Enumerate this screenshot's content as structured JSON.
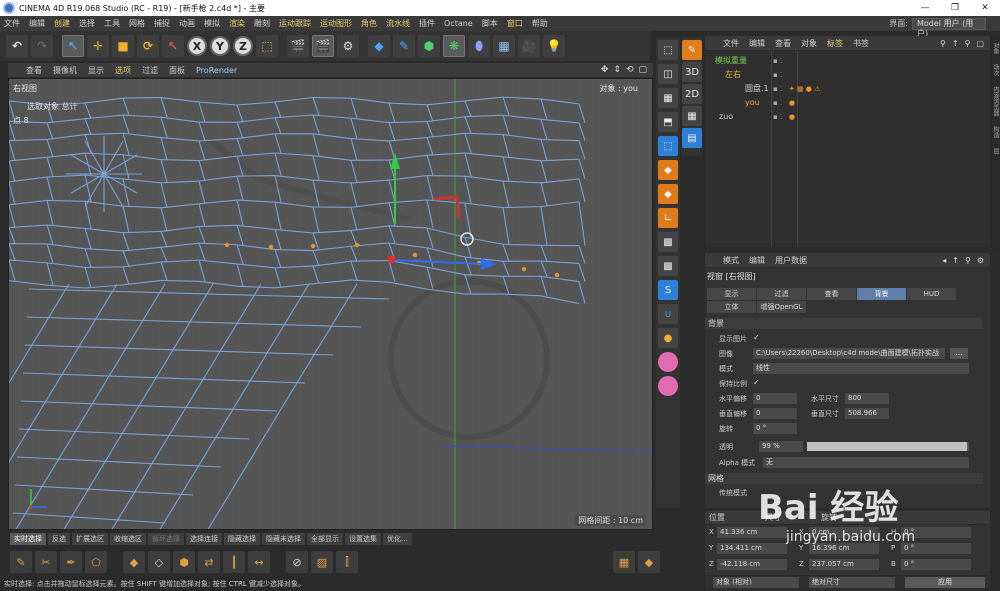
{
  "window": {
    "title": "CINEMA 4D R19.068 Studio (RC - R19) - [新手枪 2.c4d *] - 主要",
    "controls": [
      "—",
      "❐",
      "✕"
    ]
  },
  "menubar": {
    "items": [
      "文件",
      "编辑",
      "创建",
      "选择",
      "工具",
      "网格",
      "捕捉",
      "动画",
      "模拟",
      "渲染",
      "雕刻",
      "运动跟踪",
      "运动图形",
      "角色",
      "流水线",
      "插件",
      "Octane",
      "脚本",
      "窗口",
      "帮助"
    ],
    "layout_label": "界面:",
    "layout_value": "Model 用户 (用户)"
  },
  "viewport_menu": {
    "items": [
      "查看",
      "摄像机",
      "显示",
      "选项",
      "过滤",
      "面板"
    ],
    "prorender": "ProRender"
  },
  "viewport": {
    "name": "右视图",
    "selection_info": "选取对象 总计",
    "points_label": "点",
    "points_value": "8",
    "object_label": "对象 : you",
    "grid_spacing": "网格间距 : 10 cm"
  },
  "object_manager": {
    "menu": [
      "文件",
      "编辑",
      "查看",
      "对象",
      "标签",
      "书签"
    ],
    "objects": [
      {
        "name": "模拟重量",
        "indent": 0,
        "style": "green"
      },
      {
        "name": "左右",
        "indent": 1,
        "style": "sel"
      },
      {
        "name": "圆盘.1",
        "indent": 2,
        "style": "normal"
      },
      {
        "name": "you",
        "indent": 2,
        "style": "sel"
      },
      {
        "name": "zuo",
        "indent": 0,
        "style": "normal"
      }
    ]
  },
  "side_tabs": [
    "对象",
    "场次",
    "内容浏览器",
    "构造",
    "层"
  ],
  "attribute_manager": {
    "menu": [
      "模式",
      "编辑",
      "用户数据"
    ],
    "title": "视窗 [右视图]",
    "tabs_row1": [
      "显示",
      "过滤",
      "查看",
      "背景",
      "HUD"
    ],
    "active_tab": "背景",
    "tabs_row2": [
      "立体",
      "增强OpenGL"
    ],
    "section": "背景",
    "show_image_label": "显示图片",
    "show_image_checked": "✓",
    "image_label": "图像",
    "image_path": "C:\\Users\\22260\\Desktop\\c4d mode\\曲面建模\\拓扑实战",
    "browse": "...",
    "mode_label": "模式",
    "mode_value": "线性",
    "keep_ratio_label": "保持比例",
    "keep_ratio_checked": "✓",
    "h_offset_label": "水平偏移",
    "h_offset": "0",
    "h_size_label": "水平尺寸",
    "h_size": "800",
    "v_offset_label": "垂直偏移",
    "v_offset": "0",
    "v_size_label": "垂直尺寸",
    "v_size": "508.966",
    "rotate_label": "旋转",
    "rotate": "0 °",
    "transparency_label": "透明",
    "transparency": "99 %",
    "transparency_level": 0.99,
    "alpha_label": "Alpha 模式",
    "alpha_value": "无",
    "section2": "网格",
    "legacy_label": "传统模式"
  },
  "coordinates": {
    "header": [
      "位置",
      "尺寸",
      "旋转"
    ],
    "rows": [
      {
        "axis": "X",
        "value": "41.336 cm",
        "size": "0 cm",
        "rot_axis": "H",
        "rot": "0 °"
      },
      {
        "axis": "Y",
        "value": "134.411 cm",
        "size": "16.396 cm",
        "rot_axis": "P",
        "rot": "0 °"
      },
      {
        "axis": "Z",
        "value": "-42.118 cm",
        "size": "237.057 cm",
        "rot_axis": "B",
        "rot": "0 °"
      }
    ],
    "mode": "对象 (相对)",
    "size_mode": "绝对尺寸",
    "apply": "应用"
  },
  "selection_tabs": [
    "实时选择",
    "反选",
    "扩展选区",
    "收缩选区",
    "循环选择",
    "选择连接",
    "隐藏选择",
    "隐藏未选择",
    "全部显示",
    "设置选集",
    "优化..."
  ],
  "active_selection_tab": "实时选择",
  "statusbar": "实时选择: 点击并拖动鼠标选择元素。按住 SHIFT 键增加选择对象; 按住 CTRL 键减少选择对象。",
  "watermark": {
    "logo": "Bai 经验",
    "url": "jingyan.baidu.com"
  },
  "colors": {
    "accent": "#e8d070",
    "wire": "#7aa2d8",
    "point": "#e8962a",
    "axis_y": "#2ecc40",
    "axis_x": "#2f6df0",
    "selected": "#e8b13a"
  }
}
